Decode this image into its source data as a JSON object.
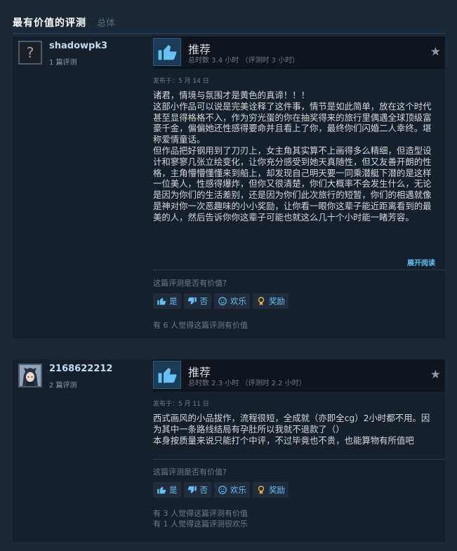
{
  "section": {
    "title": "最有价值的评测",
    "subtitle": "总体"
  },
  "reviews": [
    {
      "author": {
        "name": "shadowpk3",
        "review_count": "1 篇评测",
        "avatar": "question-mark"
      },
      "verdict": "推荐",
      "playtime": "总时数 3.4 小时  （评测时 3 小时）",
      "posted": "发布于：5 月 14 日",
      "content": [
        "诸君，情境与氛围才是黄色的真谛！！！",
        "这部小作品可以说是完美诠释了这件事，情节是如此简单，放在这个时代甚至显得格格不入，作为穷光蛋的你在抽奖得来的旅行里偶遇全球顶级富豪千金，偏偏她还性感得要命并且看上了你，最终你们闪婚二人幸终。堪称爱情童话。",
        "但作品把好钢用到了刀刃上，女主角其实算不上画得多么精细，但造型设计和寥寥几张立绘变化，让你充分感受到她天真随性，但又友善开朗的性格，主角懵懵懂懂来到船上，却发现自己明天要一同乘潜艇下潜的是这样一位美人，性感得爆炸，但你又很清楚，你们大概率不会发生什么，无论是因为你们的生活差别，还是因为你们此次旅行的短暂，你们的相遇就像是神对你一次恶趣味的小小奖励，让你看一眼你这辈子能近距离看到的最美的人，然后告诉你你这辈子可能也就这么几十个小时能一睹芳容。"
      ],
      "expand_label": "展开阅读",
      "helpful_question": "这篇评测是否有价值?",
      "buttons": {
        "yes": "是",
        "no": "否",
        "funny": "欢乐",
        "award": "奖励"
      },
      "vote_info": [
        "有 6 人觉得这篇评测有价值"
      ]
    },
    {
      "author": {
        "name": "2168622212",
        "review_count": "2 篇评测",
        "avatar": "anime-character"
      },
      "verdict": "推荐",
      "playtime": "总时数 2.3 小时  （评测时 2.2 小时）",
      "posted": "发布于：5 月 11 日",
      "content": [
        "西式画风的小品拔作，流程很短，全成就（亦即全cg）2小时都不用。因为其中一条路线结局有孕肚所以我就不退款了（）",
        "本身按质量来说只能打个中评，不过毕竟也不贵，也能算物有所值吧"
      ],
      "helpful_question": "这篇评测是否有价值?",
      "buttons": {
        "yes": "是",
        "no": "否",
        "funny": "欢乐",
        "award": "奖励"
      },
      "vote_info": [
        "有 3 人觉得这篇评测有价值",
        "有 1 人觉得这篇评测很欢乐"
      ]
    }
  ],
  "colors": {
    "background": "#1b2838",
    "link": "#66c0f4",
    "thumb_bg": "#1a3a55"
  }
}
